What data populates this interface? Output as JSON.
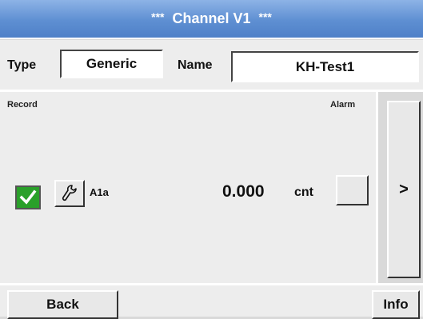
{
  "title": {
    "stars_left": "***",
    "text": "Channel V1",
    "stars_right": "***"
  },
  "header": {
    "type_label": "Type",
    "type_value": "Generic",
    "name_label": "Name",
    "name_value": "KH-Test1"
  },
  "panel": {
    "record_label": "Record",
    "alarm_label": "Alarm",
    "channel_name": "A1a",
    "value": "0.000",
    "unit": "cnt",
    "record_checked": true
  },
  "side": {
    "next_label": ">"
  },
  "footer": {
    "back_label": "Back",
    "info_label": "Info"
  },
  "colors": {
    "title_bar": "#5e8fd2",
    "check_green": "#2aa02a",
    "background": "#ededed"
  },
  "icons": [
    "check-icon",
    "wrench-icon"
  ]
}
